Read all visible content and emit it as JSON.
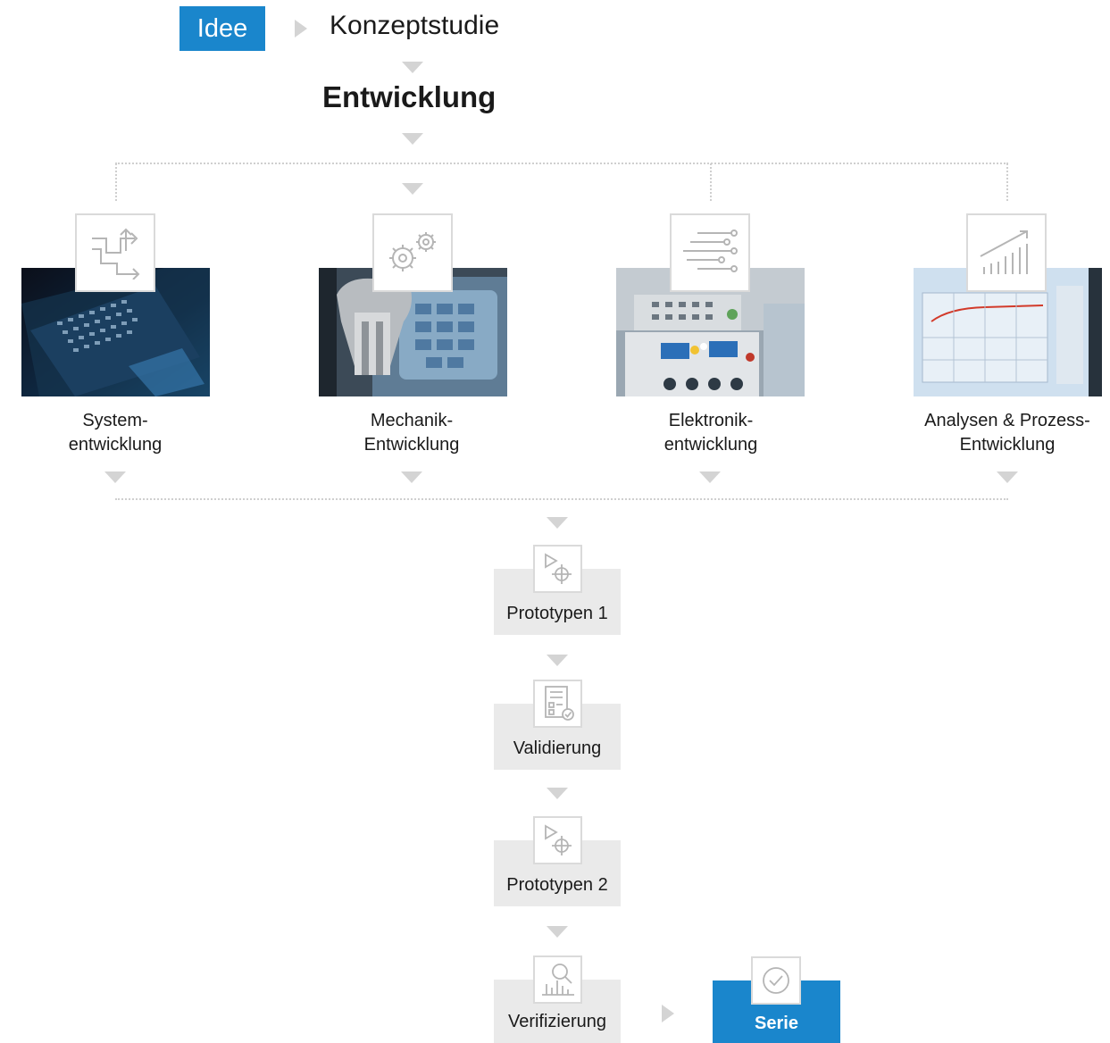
{
  "header": {
    "idee": "Idee",
    "konzeptstudie": "Konzeptstudie",
    "entwicklung": "Entwicklung"
  },
  "categories": [
    {
      "line1": "System-",
      "line2": "entwicklung",
      "icon": "workflow-arrows-icon"
    },
    {
      "line1": "Mechanik-",
      "line2": "Entwicklung",
      "icon": "gears-icon"
    },
    {
      "line1": "Elektronik-",
      "line2": "entwicklung",
      "icon": "circuit-lines-icon"
    },
    {
      "line1": "Analysen & Prozess-",
      "line2": "Entwicklung",
      "icon": "growth-chart-icon"
    }
  ],
  "steps": [
    {
      "label": "Prototypen 1",
      "icon": "prototype-target-icon"
    },
    {
      "label": "Validierung",
      "icon": "checklist-icon"
    },
    {
      "label": "Prototypen 2",
      "icon": "prototype-target-icon"
    },
    {
      "label": "Verifizierung",
      "icon": "chart-magnifier-icon"
    }
  ],
  "final": {
    "label": "Serie",
    "icon": "check-circle-icon"
  },
  "colors": {
    "accent": "#1a86cc",
    "box_gray": "#eaeaea",
    "arrow_gray": "#d4d4d4"
  }
}
